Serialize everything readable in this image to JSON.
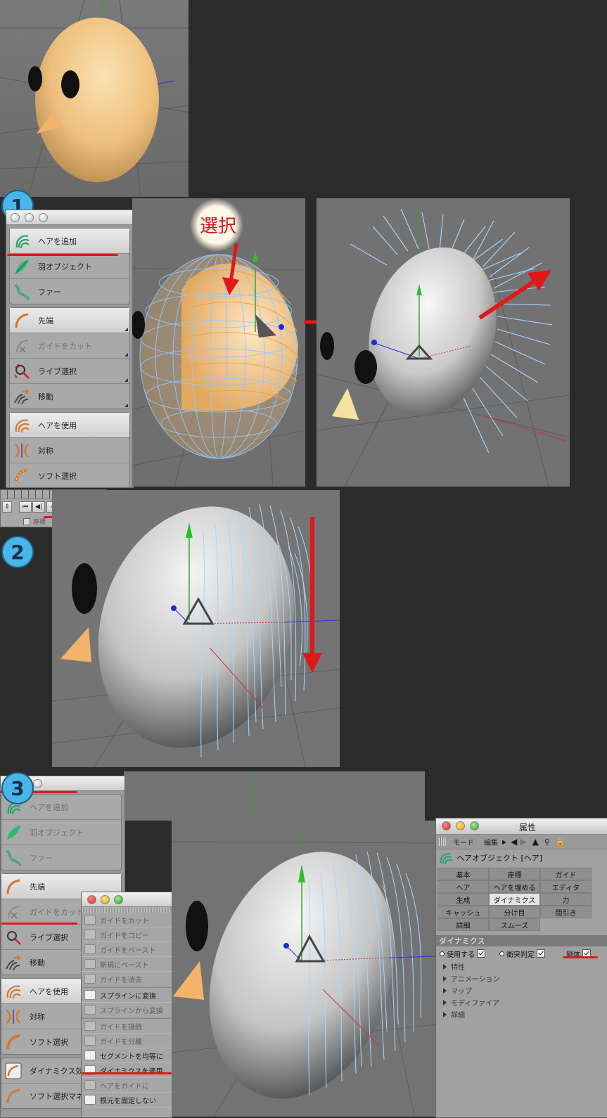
{
  "panel1": {
    "badge": "1",
    "select_label": "選択",
    "tools": {
      "group1": [
        "ヘアを追加",
        "羽オブジェクト",
        "ファー"
      ],
      "group2": [
        "先端",
        "ガイドをカット",
        "ライブ選択",
        "移動"
      ],
      "group3": [
        "ヘアを使用",
        "対称",
        "ソフト選択"
      ]
    }
  },
  "panel2": {
    "badge": "2",
    "timeline_checkbox_label": "座標"
  },
  "panel3": {
    "badge": "3",
    "tools": {
      "group1": [
        "ヘアを追加",
        "羽オブジェクト",
        "ファー"
      ],
      "group2": [
        "先端",
        "ガイドをカット",
        "ライブ選択",
        "移動"
      ],
      "group3": [
        "ヘアを使用",
        "対称",
        "ソフト選択"
      ],
      "extra": [
        "ダイナミクス効果",
        "ソフト選択マネ"
      ]
    },
    "submenu": [
      "ガイドをカット",
      "ガイドをコピー",
      "ガイドをペースト",
      "新規にペースト",
      "ガイドを消去",
      "スプラインに変換",
      "スプラインから変換",
      "ガイドを接続",
      "ガイドを分離",
      "セグメントを均等に",
      "ダイナミクスを適用",
      "ヘアをガイドに",
      "根元を固定しない"
    ],
    "attributes": {
      "title": "属性",
      "menu": [
        "モード",
        "編集"
      ],
      "object": "ヘアオブジェクト [ヘア]",
      "tabs": [
        "基本",
        "座標",
        "ガイド",
        "ヘア",
        "ヘアを埋める",
        "エディタ",
        "生成",
        "ダイナミクス",
        "力",
        "キャッシュ",
        "分け目",
        "間引き",
        "詳細",
        "スムーズ"
      ],
      "active_tab": "ダイナミクス",
      "section": "ダイナミクス",
      "options": [
        "使用する",
        "衝突判定",
        "剛体"
      ],
      "subsections": [
        "特性",
        "アニメーション",
        "マップ",
        "モディファイア",
        "詳細"
      ]
    }
  },
  "colors": {
    "annotation_red": "#e01818",
    "badge_blue": "#49b6ea",
    "hair_blue": "#a9d6ff",
    "skin": "#f3c98a"
  }
}
